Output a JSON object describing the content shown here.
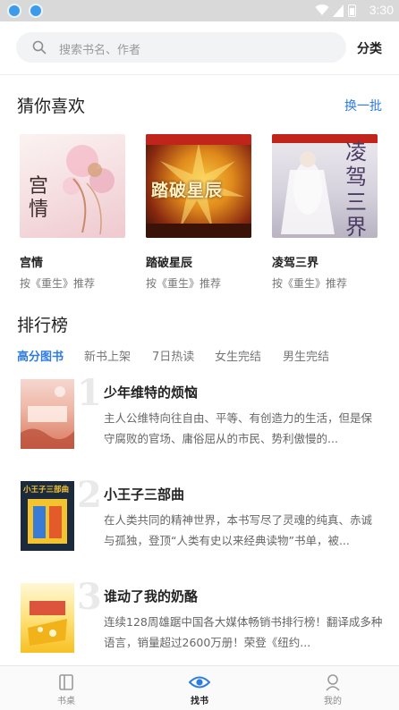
{
  "status_bar": {
    "time": "3:30"
  },
  "search": {
    "placeholder": "搜索书名、作者",
    "category_label": "分类"
  },
  "recommend": {
    "title": "猜你喜欢",
    "refresh_label": "换一批",
    "books": [
      {
        "title": "宫情",
        "rec": "按《重生》推荐",
        "cover_text": "宫情"
      },
      {
        "title": "踏破星辰",
        "rec": "按《重生》推荐",
        "cover_text": "踏破星辰"
      },
      {
        "title": "凌驾三界",
        "rec": "按《重生》推荐",
        "cover_text": "凌驾三界"
      }
    ]
  },
  "ranking": {
    "title": "排行榜",
    "tabs": [
      "高分图书",
      "新书上架",
      "7日热读",
      "女生完结",
      "男生完结"
    ],
    "active_tab": 0,
    "items": [
      {
        "rank": "1",
        "title": "少年维特的烦恼",
        "desc": "主人公维特向往自由、平等、有创造力的生活，但是保守腐败的官场、庸俗屈从的市民、势利傲慢的..."
      },
      {
        "rank": "2",
        "title": "小王子三部曲",
        "desc": "在人类共同的精神世界，本书写尽了灵魂的纯真、赤诚与孤独，登顶“人类有史以来经典读物”书单，被...",
        "cover_text": "小王子三部曲"
      },
      {
        "rank": "3",
        "title": "谁动了我的奶酪",
        "desc": "连续128周雄踞中国各大媒体畅销书排行榜！翻译成多种语言，销量超过2600万册！荣登《纽约..."
      }
    ]
  },
  "bottom_nav": [
    {
      "label": "书桌",
      "icon": "bookshelf-icon"
    },
    {
      "label": "找书",
      "icon": "eye-icon",
      "active": true
    },
    {
      "label": "我的",
      "icon": "person-icon"
    }
  ],
  "colors": {
    "accent": "#2f7ce0",
    "text": "#222222",
    "muted": "#777777"
  }
}
